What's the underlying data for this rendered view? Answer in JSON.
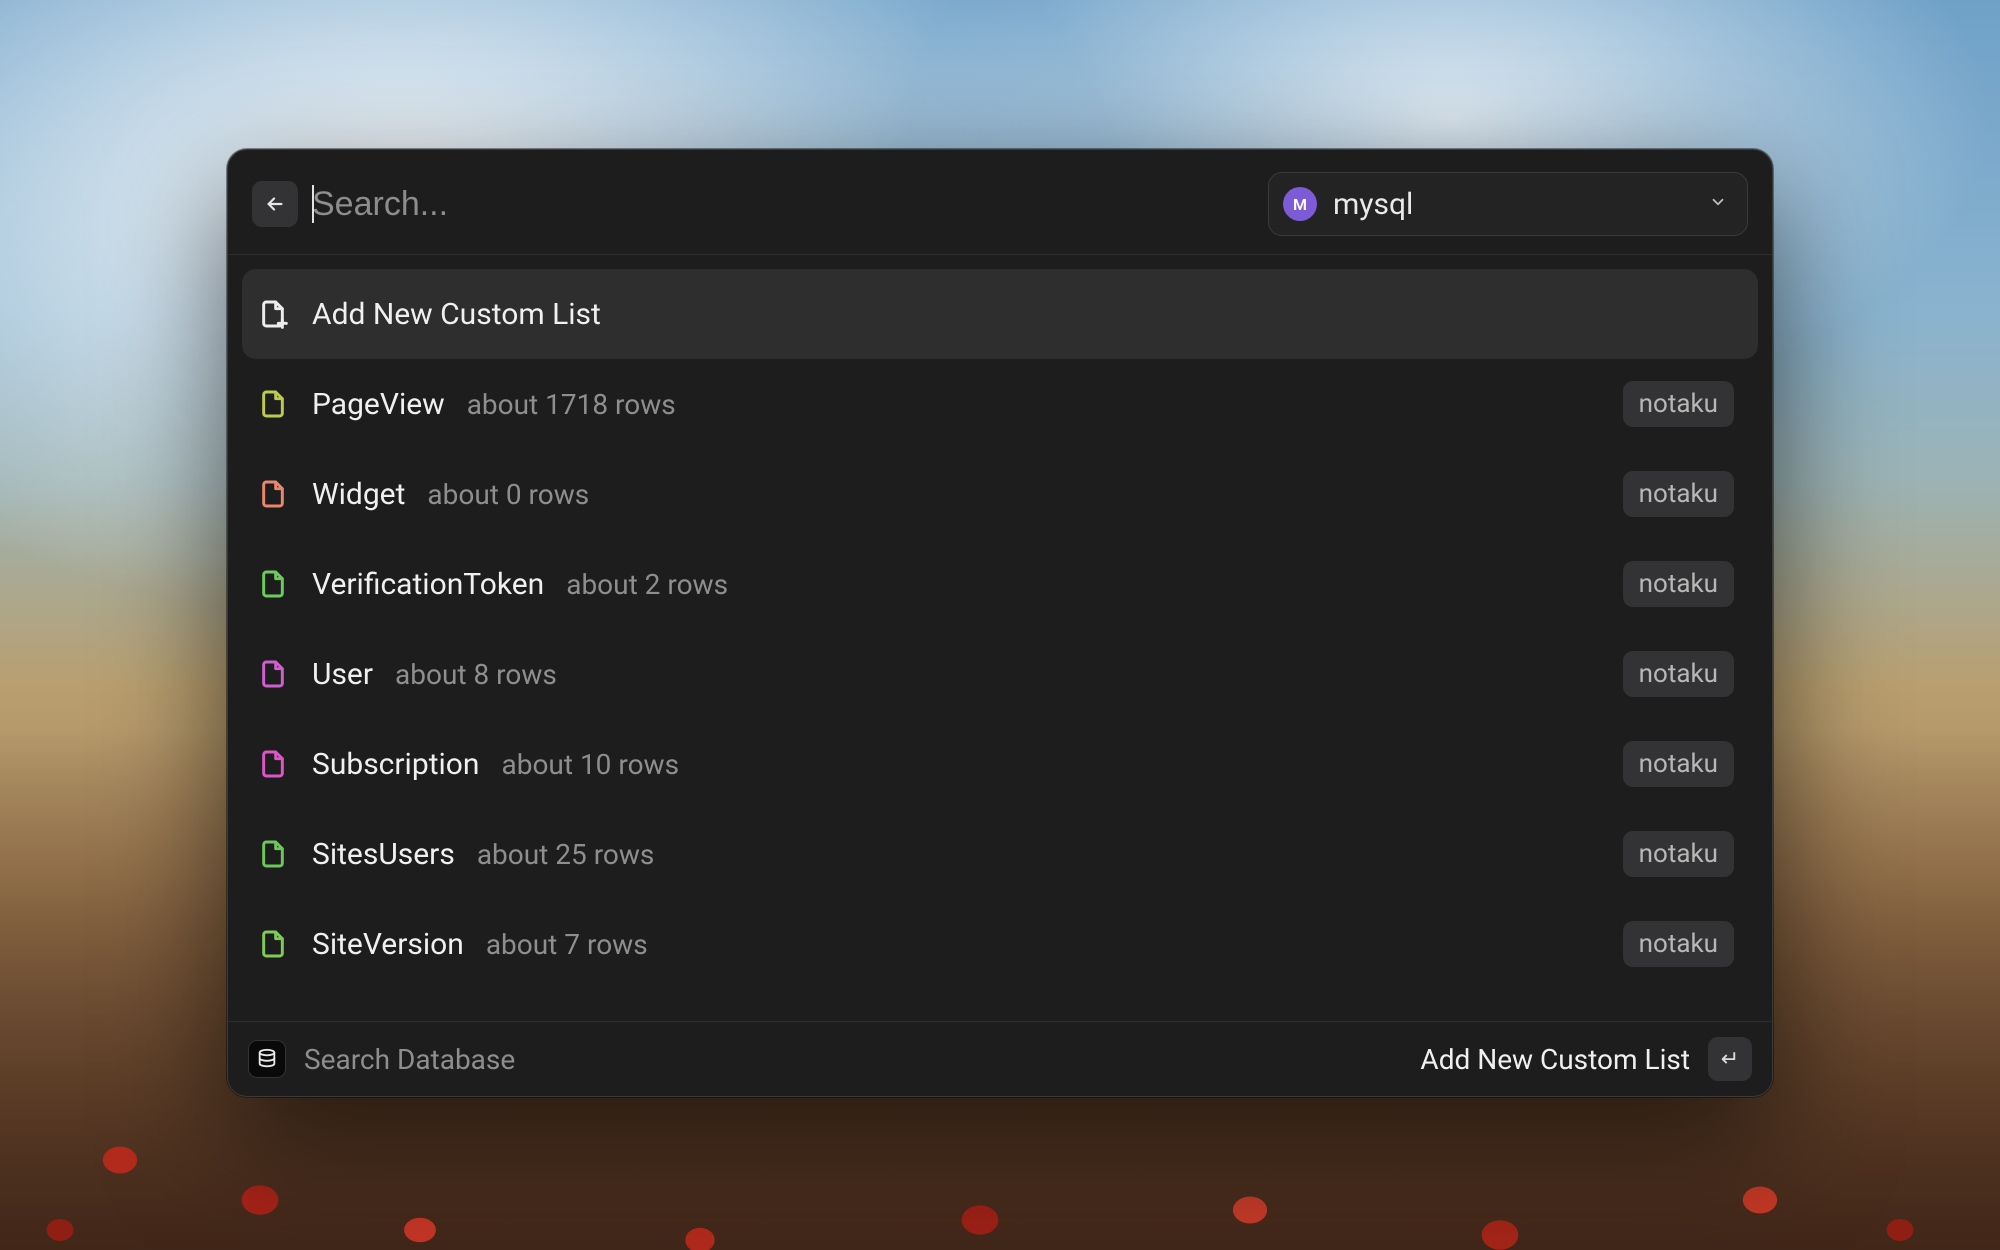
{
  "search": {
    "placeholder": "Search..."
  },
  "connection": {
    "avatar_letter": "M",
    "label": "mysql"
  },
  "add_row": {
    "label": "Add New Custom List"
  },
  "tables": [
    {
      "name": "PageView",
      "rows_text": "about 1718 rows",
      "db": "notaku",
      "icon_color": "#bcca4f"
    },
    {
      "name": "Widget",
      "rows_text": "about 0 rows",
      "db": "notaku",
      "icon_color": "#e9876c"
    },
    {
      "name": "VerificationToken",
      "rows_text": "about 2 rows",
      "db": "notaku",
      "icon_color": "#6dcb5c"
    },
    {
      "name": "User",
      "rows_text": "about 8 rows",
      "db": "notaku",
      "icon_color": "#cf5fcf"
    },
    {
      "name": "Subscription",
      "rows_text": "about 10 rows",
      "db": "notaku",
      "icon_color": "#dd56c7"
    },
    {
      "name": "SitesUsers",
      "rows_text": "about 25 rows",
      "db": "notaku",
      "icon_color": "#6cc65c"
    },
    {
      "name": "SiteVersion",
      "rows_text": "about 7 rows",
      "db": "notaku",
      "icon_color": "#7ecb58"
    }
  ],
  "footer": {
    "extension_label": "Search Database",
    "primary_action": "Add New Custom List",
    "enter_glyph": "↵"
  }
}
